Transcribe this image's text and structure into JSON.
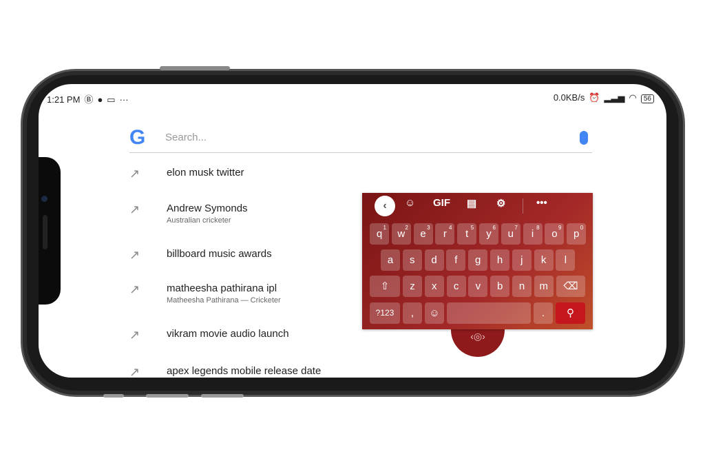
{
  "status": {
    "time": "1:21 PM",
    "left_icons": [
      "b-icon",
      "messenger-icon",
      "keyboard-icon",
      "more-icon"
    ],
    "speed": "0.0KB/s",
    "battery": "56"
  },
  "search": {
    "placeholder": "Search...",
    "logo": "G"
  },
  "suggestions": [
    {
      "title": "elon musk twitter",
      "subtitle": ""
    },
    {
      "title": "Andrew Symonds",
      "subtitle": "Australian cricketer"
    },
    {
      "title": "billboard music awards",
      "subtitle": ""
    },
    {
      "title": "matheesha pathirana ipl",
      "subtitle": "Matheesha Pathirana — Cricketer"
    },
    {
      "title": "vikram movie audio launch",
      "subtitle": ""
    },
    {
      "title": "apex legends mobile release date",
      "subtitle": ""
    }
  ],
  "keyboard": {
    "toolbar": {
      "gif": "GIF"
    },
    "row1": [
      "q",
      "w",
      "e",
      "r",
      "t",
      "y",
      "u",
      "i",
      "o",
      "p"
    ],
    "row1_hints": [
      "1",
      "2",
      "3",
      "4",
      "5",
      "6",
      "7",
      "8",
      "9",
      "0"
    ],
    "row2": [
      "a",
      "s",
      "d",
      "f",
      "g",
      "h",
      "j",
      "k",
      "l"
    ],
    "row3": [
      "z",
      "x",
      "c",
      "v",
      "b",
      "n",
      "m"
    ],
    "num_key": "?123",
    "comma": ",",
    "period": ".",
    "accent": "#c4161c"
  }
}
